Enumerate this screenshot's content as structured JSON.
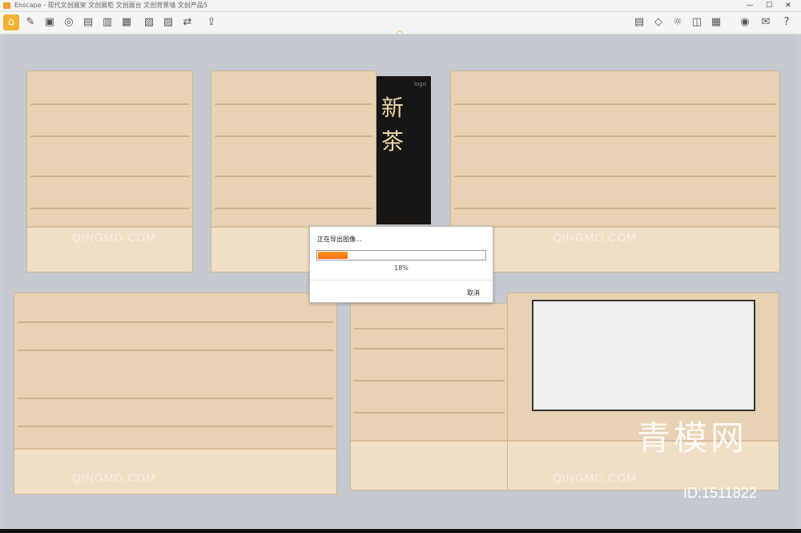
{
  "window": {
    "title": "Enscape - 现代文创展架 文创展柜 文创展台 文创背景墙 文创产品5",
    "controls": [
      "—",
      "☐",
      "✕"
    ]
  },
  "toolbar": {
    "left_icons": [
      "home-icon",
      "render-icon",
      "video-icon",
      "panorama-icon",
      "batch-icon",
      "export-icon",
      "asset-icon",
      "view-icon",
      "settings-icon",
      "compare-icon",
      "upload-icon"
    ],
    "right_icons": [
      "asset-library-icon",
      "material-icon",
      "sun-icon",
      "perspective-icon",
      "grid-icon",
      "camera-icon",
      "feedback-icon",
      "help-icon"
    ]
  },
  "dialog": {
    "title": "正在导出图像...",
    "progress": 0.18,
    "percent_label": "18%",
    "cancel_label": "取消"
  },
  "poster": {
    "glyph_top": "新",
    "glyph_bottom": "茶",
    "logo": "logo"
  },
  "watermarks": {
    "brand_latin": "QINGMO.COM",
    "brand_cn": "青模网",
    "id_label": "ID:1511822"
  },
  "colors": {
    "accent": "#f3b233",
    "progress": "#ff7a10",
    "wood": "#e7d3b4"
  }
}
